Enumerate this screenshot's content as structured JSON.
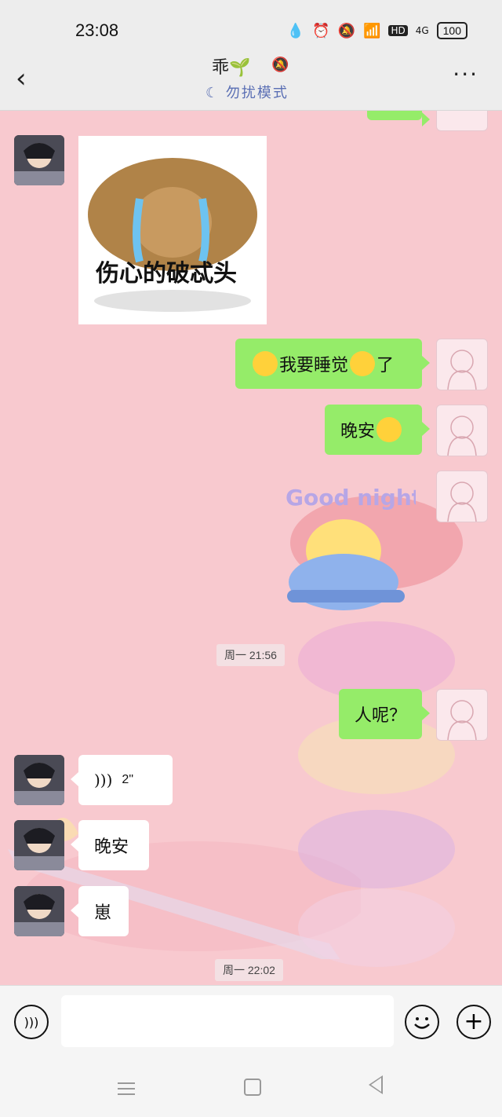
{
  "status": {
    "time": "23:08",
    "battery": "100",
    "network": "4G",
    "hd": "HD"
  },
  "header": {
    "back": "<",
    "title": "乖🌱",
    "subtitle": "勿扰模式",
    "more": "···"
  },
  "messages": {
    "sticker1_text": "伤心的破忒头",
    "msg1_text": "我要睡觉",
    "msg1_end": "了",
    "msg2_text": "晚安",
    "sticker2_text": "Good night",
    "time1": "周一 21:56",
    "msg3_text": "人呢？",
    "voice_duration": "2\"",
    "msg4_text": "晚安",
    "msg5_text": "崽",
    "time2": "周一 22:02"
  },
  "input": {
    "placeholder": ""
  }
}
